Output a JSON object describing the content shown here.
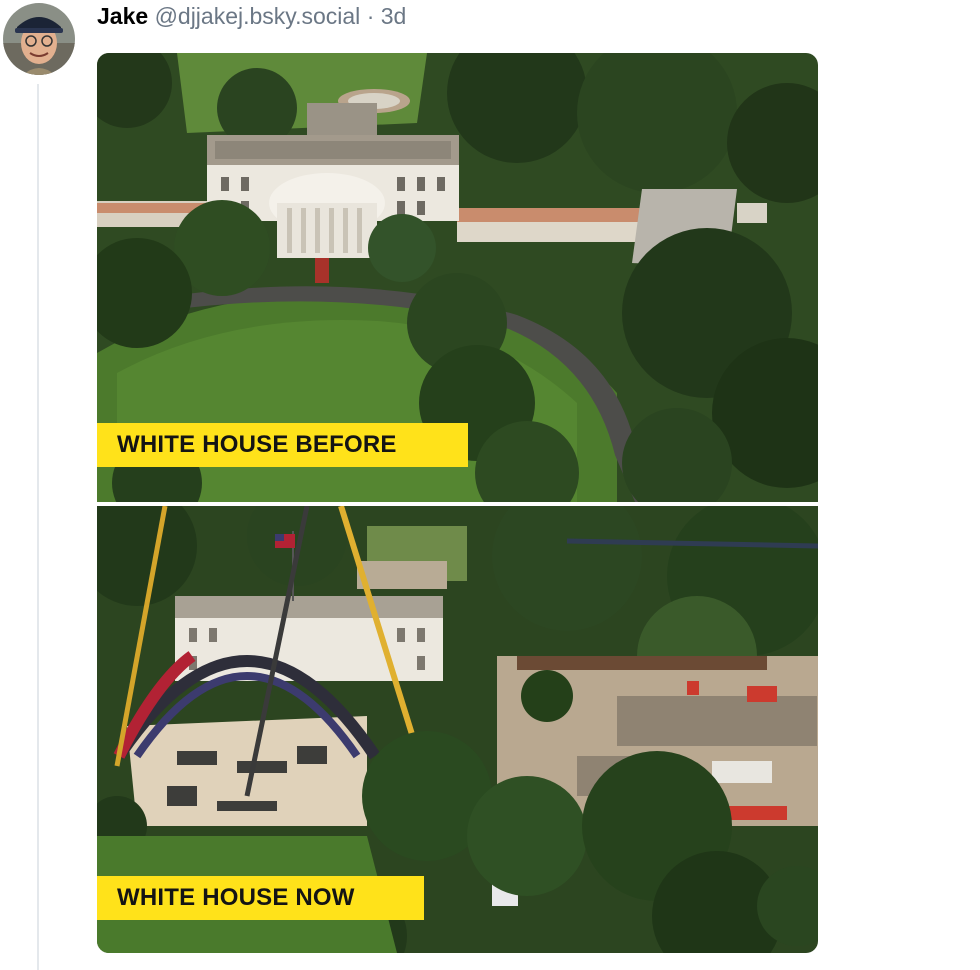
{
  "post": {
    "author": {
      "display_name": "Jake",
      "handle": "@djjakej.bsky.social",
      "avatar_icon": "user-avatar"
    },
    "separator": "·",
    "time_ago": "3d"
  },
  "media": {
    "before": {
      "caption": "WHITE HOUSE BEFORE"
    },
    "now": {
      "caption": "WHITE HOUSE NOW"
    }
  },
  "colors": {
    "caption_background": "#ffe21a",
    "caption_text": "#141414",
    "handle_text": "#6b7785",
    "thread_line": "#e4e8ec"
  }
}
